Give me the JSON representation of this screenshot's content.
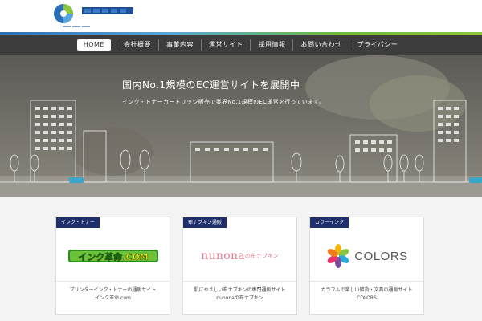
{
  "header": {
    "logo_icon": "circle-logo-icon",
    "brand_color": "#2b6eb8",
    "accent_color": "#8cc63f"
  },
  "nav": {
    "items": [
      {
        "label": "HOME",
        "active": true
      },
      {
        "label": "会社概要"
      },
      {
        "label": "事業内容"
      },
      {
        "label": "運営サイト"
      },
      {
        "label": "採用情報"
      },
      {
        "label": "お問い合わせ"
      },
      {
        "label": "プライバシー"
      }
    ]
  },
  "hero": {
    "title": "国内No.1規模のEC運営サイトを展開中",
    "subtitle": "インク・トナーカートリッジ販売で業界No.1規模のEC運営を行っています。"
  },
  "cards": [
    {
      "badge": "インク・トナー",
      "logo_text": "インク革命.COM",
      "desc_line1": "プリンターインク・トナーの通販サイト",
      "desc_line2": "インク革命.com"
    },
    {
      "badge": "布ナプキン通販",
      "logo_text": "nunona",
      "logo_suffix": "の布ナプキン",
      "desc_line1": "肌にやさしい布ナプキンの専門通販サイト",
      "desc_line2": "nunonaの布ナプキン"
    },
    {
      "badge": "カラーインク",
      "logo_text": "COLORS",
      "desc_line1": "カラフルで楽しい雑貨・文具の通販サイト",
      "desc_line2": "COLORS"
    }
  ]
}
